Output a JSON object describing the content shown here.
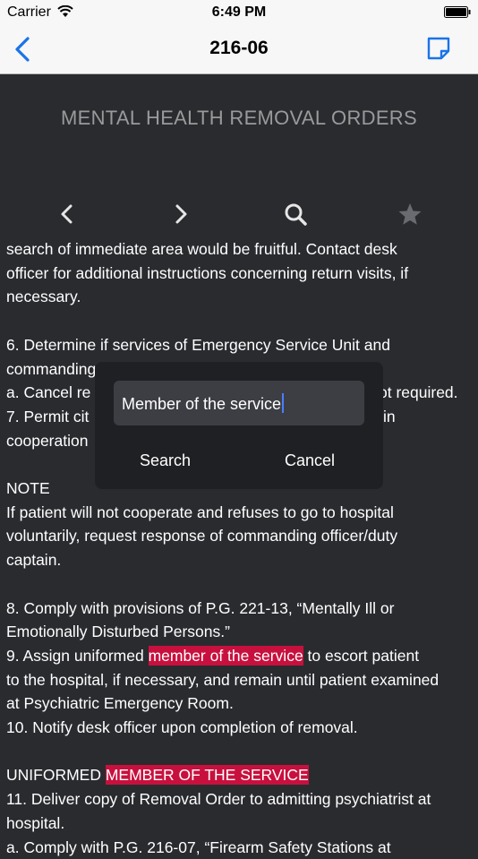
{
  "status_bar": {
    "carrier": "Carrier",
    "time": "6:49 PM"
  },
  "nav": {
    "title": "216-06",
    "back_icon": "chevron-left-icon",
    "note_icon": "note-edit-icon"
  },
  "document": {
    "title": "MENTAL HEALTH REMOVAL ORDERS",
    "toolbar": [
      "chevron-left-icon",
      "chevron-right-icon",
      "search-icon",
      "star-icon"
    ],
    "lines": {
      "l1": "search of immediate area would be fruitful. Contact desk",
      "l2": "officer for additional instructions concerning return visits, if",
      "l3": "necessary.",
      "l5": "6. Determine if services of Emergency Service Unit and",
      "l6": "commanding",
      "l7a": "a. Cancel re",
      "l7b": "ot required.",
      "l8a": "7. Permit cit",
      "l8b": "in",
      "l9": "cooperation",
      "l11": "NOTE",
      "l12": "If patient will not cooperate and refuses to go to hospital",
      "l13": "voluntarily, request response of commanding officer/duty",
      "l14": "captain.",
      "l16": "8. Comply with provisions of P.G. 221-13, “Mentally Ill or",
      "l17": "Emotionally Disturbed Persons.”",
      "l18a": "9. Assign uniformed ",
      "l18hl": "member of the service",
      "l18b": " to escort patient",
      "l19": "to the hospital, if necessary, and remain until patient examined",
      "l20": "at Psychiatric Emergency Room.",
      "l21": "10. Notify desk officer upon completion of removal.",
      "l23a": "UNIFORMED ",
      "l23hl": "MEMBER OF THE SERVICE",
      "l24": "11. Deliver copy of Removal Order to admitting psychiatrist at",
      "l25": "hospital.",
      "l26": "a. Comply with P.G. 216-07, “Firearm Safety Stations at"
    }
  },
  "search_popup": {
    "query": "Member of the service",
    "search_label": "Search",
    "cancel_label": "Cancel"
  },
  "colors": {
    "highlight": "#c8103e",
    "accent": "#1a73e8",
    "background": "#2a2b2f"
  }
}
